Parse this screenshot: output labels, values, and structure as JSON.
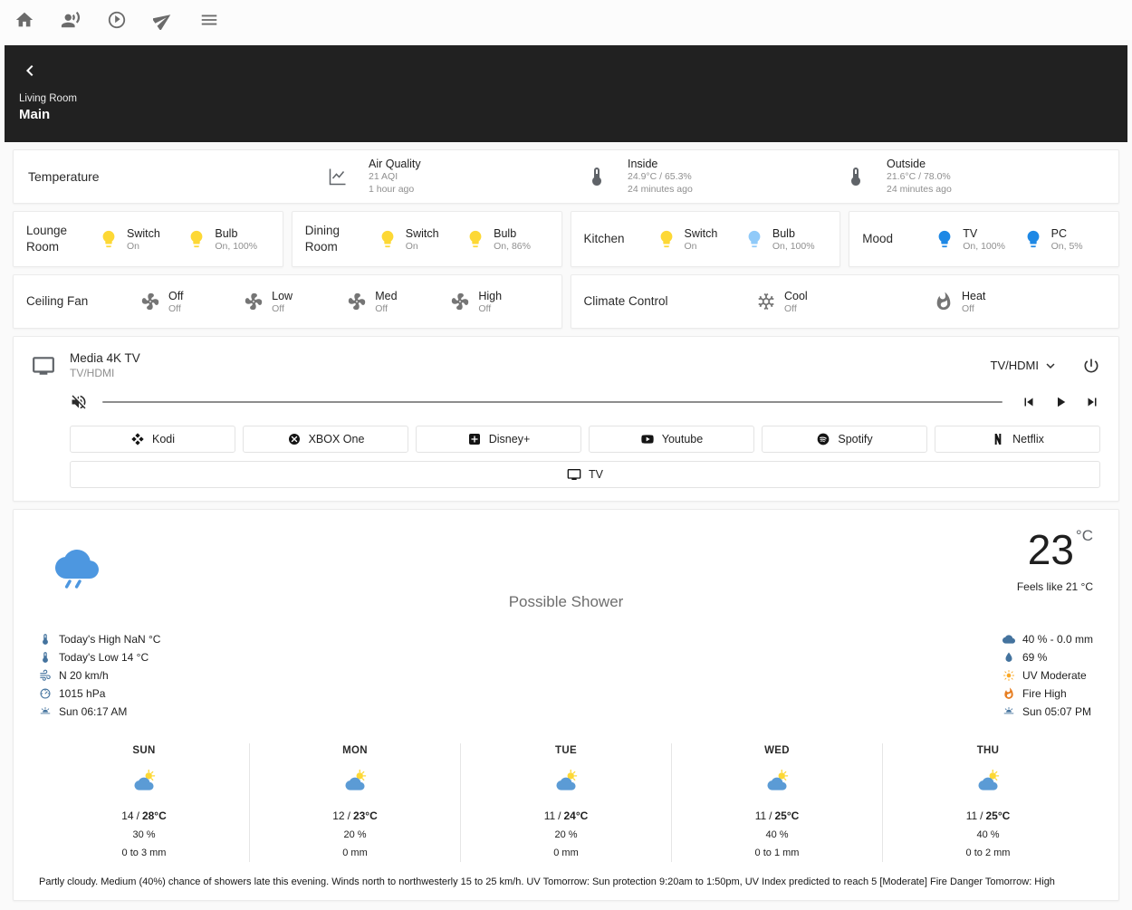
{
  "topbar": {
    "icons": [
      {
        "name": "home"
      },
      {
        "name": "voice-assistant"
      },
      {
        "name": "media-play"
      },
      {
        "name": "send"
      },
      {
        "name": "menu"
      }
    ]
  },
  "header": {
    "back_icon": "back",
    "subtitle": "Living Room",
    "title": "Main"
  },
  "sensors": {
    "title": "Temperature",
    "items": [
      {
        "icon": "chart-line",
        "label": "Air Quality",
        "value": "21 AQI",
        "updated": "1 hour ago"
      },
      {
        "icon": "thermometer",
        "label": "Inside",
        "value": "24.9°C / 65.3%",
        "updated": "24 minutes ago"
      },
      {
        "icon": "thermometer",
        "label": "Outside",
        "value": "21.6°C / 78.0%",
        "updated": "24 minutes ago"
      }
    ]
  },
  "rooms": [
    {
      "name": "Lounge Room",
      "devices": [
        {
          "icon": "bulb",
          "color": "#fdd835",
          "label": "Switch",
          "state": "On"
        },
        {
          "icon": "bulb",
          "color": "#fdd835",
          "label": "Bulb",
          "state": "On, 100%"
        }
      ]
    },
    {
      "name": "Dining Room",
      "devices": [
        {
          "icon": "bulb",
          "color": "#fdd835",
          "label": "Switch",
          "state": "On"
        },
        {
          "icon": "bulb",
          "color": "#fdd835",
          "label": "Bulb",
          "state": "On, 86%"
        }
      ]
    },
    {
      "name": "Kitchen",
      "devices": [
        {
          "icon": "bulb",
          "color": "#fdd835",
          "label": "Switch",
          "state": "On"
        },
        {
          "icon": "bulb",
          "color": "#90caf9",
          "label": "Bulb",
          "state": "On, 100%"
        }
      ]
    },
    {
      "name": "Mood",
      "devices": [
        {
          "icon": "bulb",
          "color": "#1e88e5",
          "label": "TV",
          "state": "On, 100%"
        },
        {
          "icon": "bulb",
          "color": "#1e88e5",
          "label": "PC",
          "state": "On, 5%"
        }
      ]
    }
  ],
  "ceiling_fan": {
    "name": "Ceiling Fan",
    "modes": [
      {
        "icon": "fan",
        "label": "Off",
        "state": "Off"
      },
      {
        "icon": "fan",
        "label": "Low",
        "state": "Off"
      },
      {
        "icon": "fan",
        "label": "Med",
        "state": "Off"
      },
      {
        "icon": "fan",
        "label": "High",
        "state": "Off"
      }
    ]
  },
  "climate": {
    "name": "Climate Control",
    "modes": [
      {
        "icon": "snowflake",
        "label": "Cool",
        "state": "Off"
      },
      {
        "icon": "fire",
        "label": "Heat",
        "state": "Off"
      }
    ]
  },
  "media": {
    "icon": "tv",
    "title": "Media 4K TV",
    "subtitle": "TV/HDMI",
    "source_selector": "TV/HDMI",
    "source_chevron_icon": "chevron-down",
    "power_icon": "power",
    "volume_icon": "volume-off",
    "controls": [
      "skip-previous",
      "play",
      "skip-next"
    ],
    "apps": [
      {
        "icon": "kodi",
        "label": "Kodi"
      },
      {
        "icon": "xbox",
        "label": "XBOX One"
      },
      {
        "icon": "disney-plus",
        "label": "Disney+"
      },
      {
        "icon": "youtube",
        "label": "Youtube"
      },
      {
        "icon": "spotify",
        "label": "Spotify"
      },
      {
        "icon": "netflix",
        "label": "Netflix"
      }
    ],
    "tv_button": {
      "icon": "tv",
      "label": "TV"
    }
  },
  "weather": {
    "icon": "rain-cloud",
    "icon_color": "#4d97e0",
    "temperature": "23",
    "unit": "°C",
    "feels_like": "Feels like 21 °C",
    "condition": "Possible Shower",
    "temp_separator": "/",
    "details_left": [
      {
        "icon": "thermometer",
        "color": "#44739e",
        "text": "Today's High NaN °C"
      },
      {
        "icon": "thermometer",
        "color": "#44739e",
        "text": "Today's Low 14 °C"
      },
      {
        "icon": "wind",
        "color": "#44739e",
        "text": "N 20 km/h"
      },
      {
        "icon": "gauge",
        "color": "#44739e",
        "text": "1015 hPa"
      },
      {
        "icon": "sunrise",
        "color": "#44739e",
        "text": "Sun 06:17 AM"
      }
    ],
    "details_right": [
      {
        "icon": "rain-chance",
        "color": "#44739e",
        "text": "40 % - 0.0 mm"
      },
      {
        "icon": "humidity",
        "color": "#44739e",
        "text": "69 %"
      },
      {
        "icon": "uv",
        "color": "#f9a825",
        "text": "UV Moderate"
      },
      {
        "icon": "fire",
        "color": "#e67e22",
        "text": "Fire High"
      },
      {
        "icon": "sunset",
        "color": "#44739e",
        "text": "Sun 05:07 PM"
      }
    ],
    "forecast": [
      {
        "day": "SUN",
        "icon": "partly-cloudy",
        "low": "14",
        "high": "28°C",
        "chance": "30 %",
        "rain": "0 to 3 mm"
      },
      {
        "day": "MON",
        "icon": "partly-cloudy",
        "low": "12",
        "high": "23°C",
        "chance": "20 %",
        "rain": "0 mm"
      },
      {
        "day": "TUE",
        "icon": "partly-cloudy",
        "low": "11",
        "high": "24°C",
        "chance": "20 %",
        "rain": "0 mm"
      },
      {
        "day": "WED",
        "icon": "partly-cloudy",
        "low": "11",
        "high": "25°C",
        "chance": "40 %",
        "rain": "0 to 1 mm"
      },
      {
        "day": "THU",
        "icon": "partly-cloudy",
        "low": "11",
        "high": "25°C",
        "chance": "40 %",
        "rain": "0 to 2 mm"
      }
    ],
    "summary": "Partly cloudy. Medium (40%) chance of showers late this evening. Winds north to northwesterly 15 to 25 km/h. UV Tomorrow: Sun protection 9:20am to 1:50pm, UV Index predicted to reach 5 [Moderate] Fire Danger Tomorrow: High"
  }
}
